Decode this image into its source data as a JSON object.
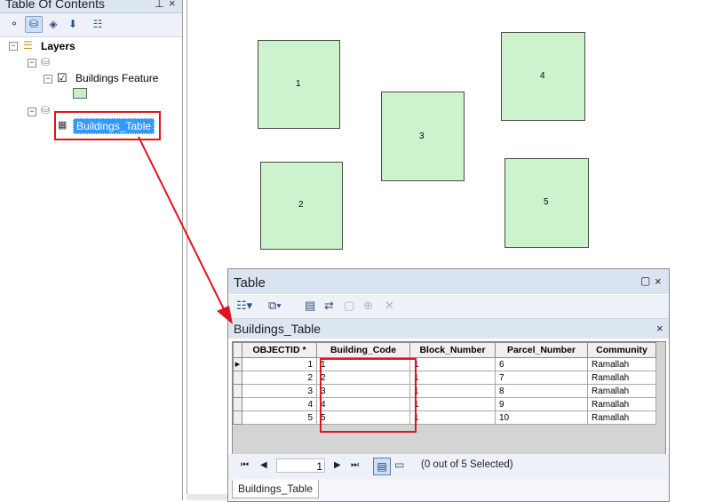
{
  "toc": {
    "title": "Table Of Contents",
    "pin_icon": "pin-icon",
    "close_icon": "close-icon",
    "layers_label": "Layers",
    "feature_layer": "Buildings Feature",
    "table_item": "Buildings_Table",
    "symbol_color": "#c8f0c8"
  },
  "map": {
    "parcels": [
      {
        "label": "1"
      },
      {
        "label": "2"
      },
      {
        "label": "3"
      },
      {
        "label": "4"
      },
      {
        "label": "5"
      }
    ],
    "fill_color": "#cdf3cd"
  },
  "table_window": {
    "title": "Table",
    "tab_title": "Buildings_Table",
    "columns": [
      "OBJECTID *",
      "Building_Code",
      "Block_Number",
      "Parcel_Number",
      "Community"
    ],
    "rows": [
      {
        "objectid": "1",
        "building_code": "1",
        "block_number": "1",
        "parcel_number": "6",
        "community": "Ramallah"
      },
      {
        "objectid": "2",
        "building_code": "2",
        "block_number": "1",
        "parcel_number": "7",
        "community": "Ramallah"
      },
      {
        "objectid": "3",
        "building_code": "3",
        "block_number": "1",
        "parcel_number": "8",
        "community": "Ramallah"
      },
      {
        "objectid": "4",
        "building_code": "4",
        "block_number": "1",
        "parcel_number": "9",
        "community": "Ramallah"
      },
      {
        "objectid": "5",
        "building_code": "5",
        "block_number": "1",
        "parcel_number": "10",
        "community": "Ramallah"
      }
    ],
    "current_record": "1",
    "selection_status": "(0 out of 5 Selected)",
    "bottom_tab": "Buildings_Table"
  },
  "annotation_color": "#e0141e"
}
